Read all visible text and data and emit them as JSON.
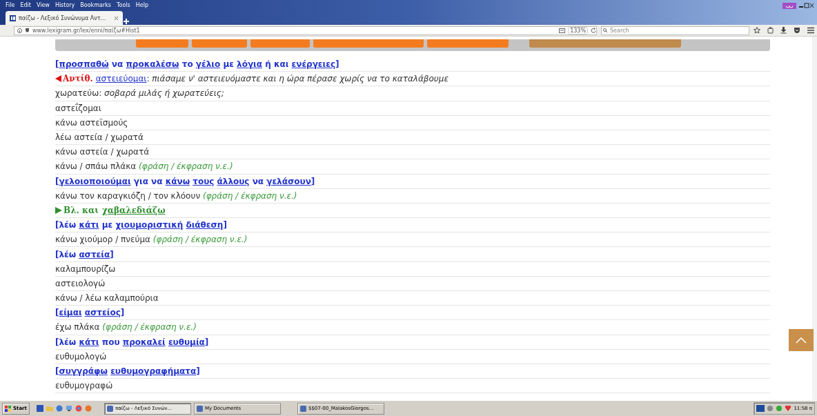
{
  "browser": {
    "menu": [
      "File",
      "Edit",
      "View",
      "History",
      "Bookmarks",
      "Tools",
      "Help"
    ],
    "tabs": [
      {
        "title": "παίζω - Λεξικό Συνώνυμα Αντ...",
        "selected": true
      }
    ],
    "address": "www.lexigram.gr/lex/enni/παίζω#Hist1",
    "zoom": "133%",
    "search": {
      "placeholder": "Search"
    }
  },
  "nav_buttons": [
    {
      "color": "#f47c20"
    },
    {
      "color": "#f47c20"
    },
    {
      "color": "#f47c20"
    },
    {
      "color": "#f47c20"
    },
    {
      "color": "#f47c20"
    },
    {
      "color": "#c08a4c"
    }
  ],
  "entries": [
    {
      "kind": "heading",
      "open": "[",
      "close": "]",
      "words": [
        {
          "text": "προσπαθώ",
          "link": true
        },
        {
          "text": "να",
          "link": false
        },
        {
          "text": "προκαλέσω",
          "link": true
        },
        {
          "text": "το",
          "link": false
        },
        {
          "text": "γέλιο",
          "link": true
        },
        {
          "text": "με",
          "link": false
        },
        {
          "text": "λόγια",
          "link": true
        },
        {
          "text": "ή και",
          "link": false
        },
        {
          "text": "ενέργειες",
          "link": true
        }
      ]
    },
    {
      "kind": "antonym",
      "label": "Αντίθ.",
      "link": "αστειεύομαι",
      "example": ": *πιάσαμε ν' αστειευόμαστε και η ώρα πέρασε χωρίς να το καταλάβουμε*"
    },
    {
      "kind": "plain",
      "text": "χωρατεύω: *σοβαρά μιλάς ή χωρατεύεις;*"
    },
    {
      "kind": "plain",
      "text": "αστεΐζομαι"
    },
    {
      "kind": "plain",
      "text": "κάνω αστεϊσμούς"
    },
    {
      "kind": "plain",
      "text": "λέω αστεία / χωρατά"
    },
    {
      "kind": "plain",
      "text": "κάνω αστεία / χωρατά"
    },
    {
      "kind": "plain",
      "text": "κάνω / σπάω πλάκα",
      "note": "(φράση / έκφραση ν.ε.)"
    },
    {
      "kind": "heading",
      "open": "[",
      "close": "]",
      "words": [
        {
          "text": "γελοιοποιούμαι",
          "link": true
        },
        {
          "text": "για να",
          "link": false
        },
        {
          "text": "κάνω",
          "link": true
        },
        {
          "text": "τους",
          "link": true
        },
        {
          "text": "άλλους",
          "link": true
        },
        {
          "text": "να",
          "link": false
        },
        {
          "text": "γελάσουν",
          "link": true
        }
      ]
    },
    {
      "kind": "plain",
      "text": "κάνω τον καραγκιόζη / τον κλόουν",
      "note": "(φράση / έκφραση ν.ε.)"
    },
    {
      "kind": "see_also",
      "label": "Βλ. και",
      "link": "χαβαλεδιάζω"
    },
    {
      "kind": "heading",
      "open": "[",
      "close": "]",
      "words": [
        {
          "text": "λέω",
          "link": false
        },
        {
          "text": "κάτι",
          "link": true
        },
        {
          "text": "με",
          "link": false
        },
        {
          "text": "χιουμοριστική",
          "link": true
        },
        {
          "text": "διάθεση",
          "link": true
        }
      ]
    },
    {
      "kind": "plain",
      "text": "κάνω χιούμορ / πνεύμα",
      "note": "(φράση / έκφραση ν.ε.)"
    },
    {
      "kind": "heading",
      "open": "[",
      "close": "]",
      "words": [
        {
          "text": "λέω",
          "link": false
        },
        {
          "text": "αστεία",
          "link": true
        }
      ]
    },
    {
      "kind": "plain",
      "text": "καλαμπουρίζω"
    },
    {
      "kind": "plain",
      "text": "αστειολογώ"
    },
    {
      "kind": "plain",
      "text": "κάνω / λέω καλαμπούρια"
    },
    {
      "kind": "heading",
      "open": "[",
      "close": "]",
      "words": [
        {
          "text": "είμαι",
          "link": true
        },
        {
          "text": "αστείος",
          "link": true
        }
      ]
    },
    {
      "kind": "plain",
      "text": "έχω πλάκα",
      "note": "(φράση / έκφραση ν.ε.)"
    },
    {
      "kind": "heading",
      "open": "[",
      "close": "]",
      "words": [
        {
          "text": "λέω",
          "link": false
        },
        {
          "text": "κάτι",
          "link": true
        },
        {
          "text": "που",
          "link": false
        },
        {
          "text": "προκαλεί",
          "link": true
        },
        {
          "text": "ευθυμία",
          "link": true
        }
      ]
    },
    {
      "kind": "plain",
      "text": "ευθυμολογώ"
    },
    {
      "kind": "heading",
      "open": "[",
      "close": "]",
      "words": [
        {
          "text": "συγγράφω",
          "link": true
        },
        {
          "text": "ευθυμογραφήματα",
          "link": true
        }
      ]
    },
    {
      "kind": "plain",
      "text": "ευθυμογραφώ"
    }
  ],
  "taskbar": {
    "start": "Start",
    "windows": [
      {
        "title": "παίζω - Λεξικό Συνών...",
        "selected": true
      },
      {
        "title": "My Documents",
        "selected": false
      },
      {
        "title": "$$07-00_MalakosGiorgos...",
        "selected": false
      }
    ],
    "clock": "11:58 π"
  }
}
